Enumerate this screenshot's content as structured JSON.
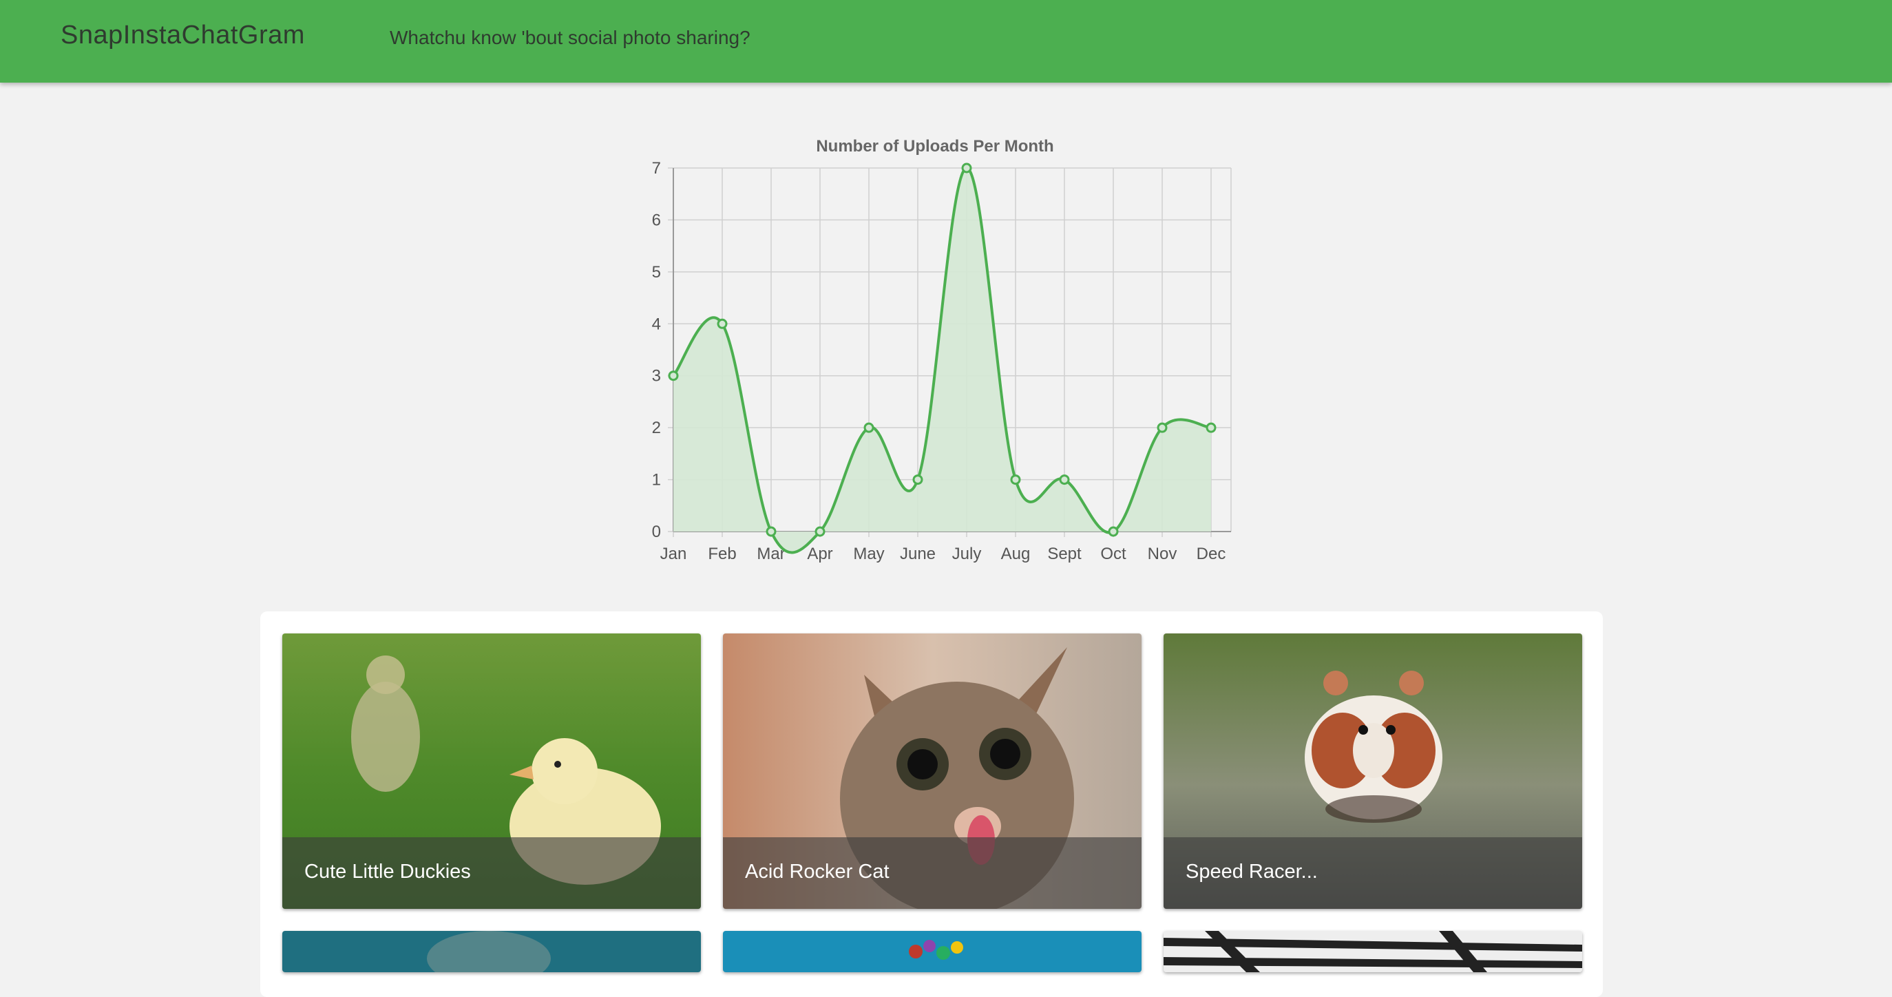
{
  "header": {
    "brand": "SnapInstaChatGram",
    "tagline": "Whatchu know 'bout social photo sharing?"
  },
  "colors": {
    "header_bg": "#4caf50",
    "line": "#4caf50",
    "fill": "#d4e8d4",
    "page_bg": "#f2f2f2"
  },
  "chart_data": {
    "type": "area",
    "title": "Number of Uploads Per Month",
    "categories": [
      "Jan",
      "Feb",
      "Mar",
      "Apr",
      "May",
      "June",
      "July",
      "Aug",
      "Sept",
      "Oct",
      "Nov",
      "Dec"
    ],
    "values": [
      3,
      4,
      0,
      0,
      2,
      1,
      7,
      1,
      1,
      0,
      2,
      2
    ],
    "ylim": [
      0,
      7
    ],
    "yticks": [
      "0",
      "1",
      "2",
      "3",
      "4",
      "5",
      "6",
      "7"
    ],
    "grid": true,
    "smooth": true
  },
  "gallery": {
    "cards": [
      {
        "caption": "Cute Little Duckies",
        "icon": "ducklings-photo"
      },
      {
        "caption": "Acid Rocker Cat",
        "icon": "cat-photo"
      },
      {
        "caption": "Speed Racer...",
        "icon": "hamster-photo"
      }
    ],
    "next_row": [
      {
        "icon": "underwater-photo"
      },
      {
        "icon": "coral-reef-photo"
      },
      {
        "icon": "zebra-pattern-photo"
      }
    ]
  }
}
